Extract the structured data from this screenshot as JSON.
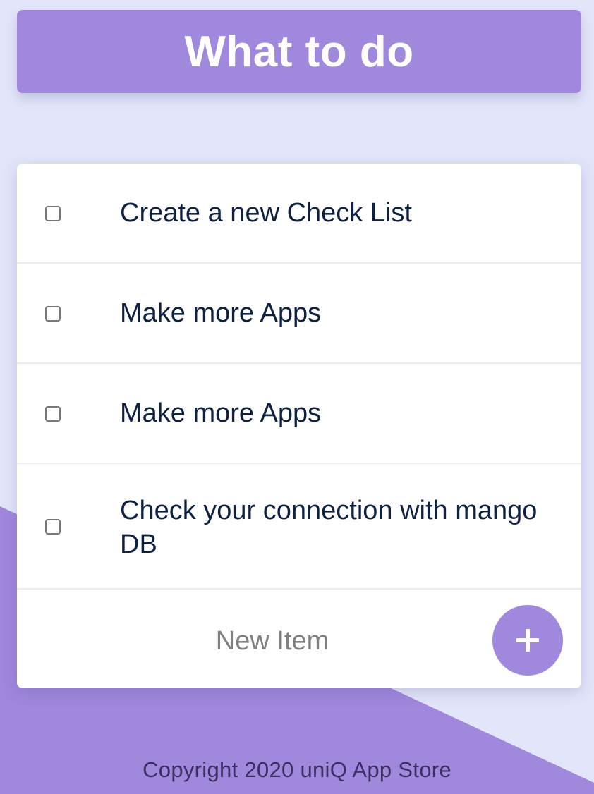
{
  "header": {
    "title": "What to do"
  },
  "todo_list": {
    "items": [
      {
        "label": "Create a new Check List",
        "checked": false
      },
      {
        "label": "Make more Apps",
        "checked": false
      },
      {
        "label": "Make more Apps",
        "checked": false
      },
      {
        "label": "Check your connection with mango DB",
        "checked": false
      }
    ],
    "new_item": {
      "value": "",
      "placeholder": "New Item",
      "add_icon": "plus-icon"
    }
  },
  "footer": {
    "copyright": "Copyright 2020 uniQ App Store"
  },
  "colors": {
    "accent": "#a088dc",
    "background": "#e3e6fa",
    "text": "#0f2142",
    "footer_text": "#3b2f63"
  }
}
